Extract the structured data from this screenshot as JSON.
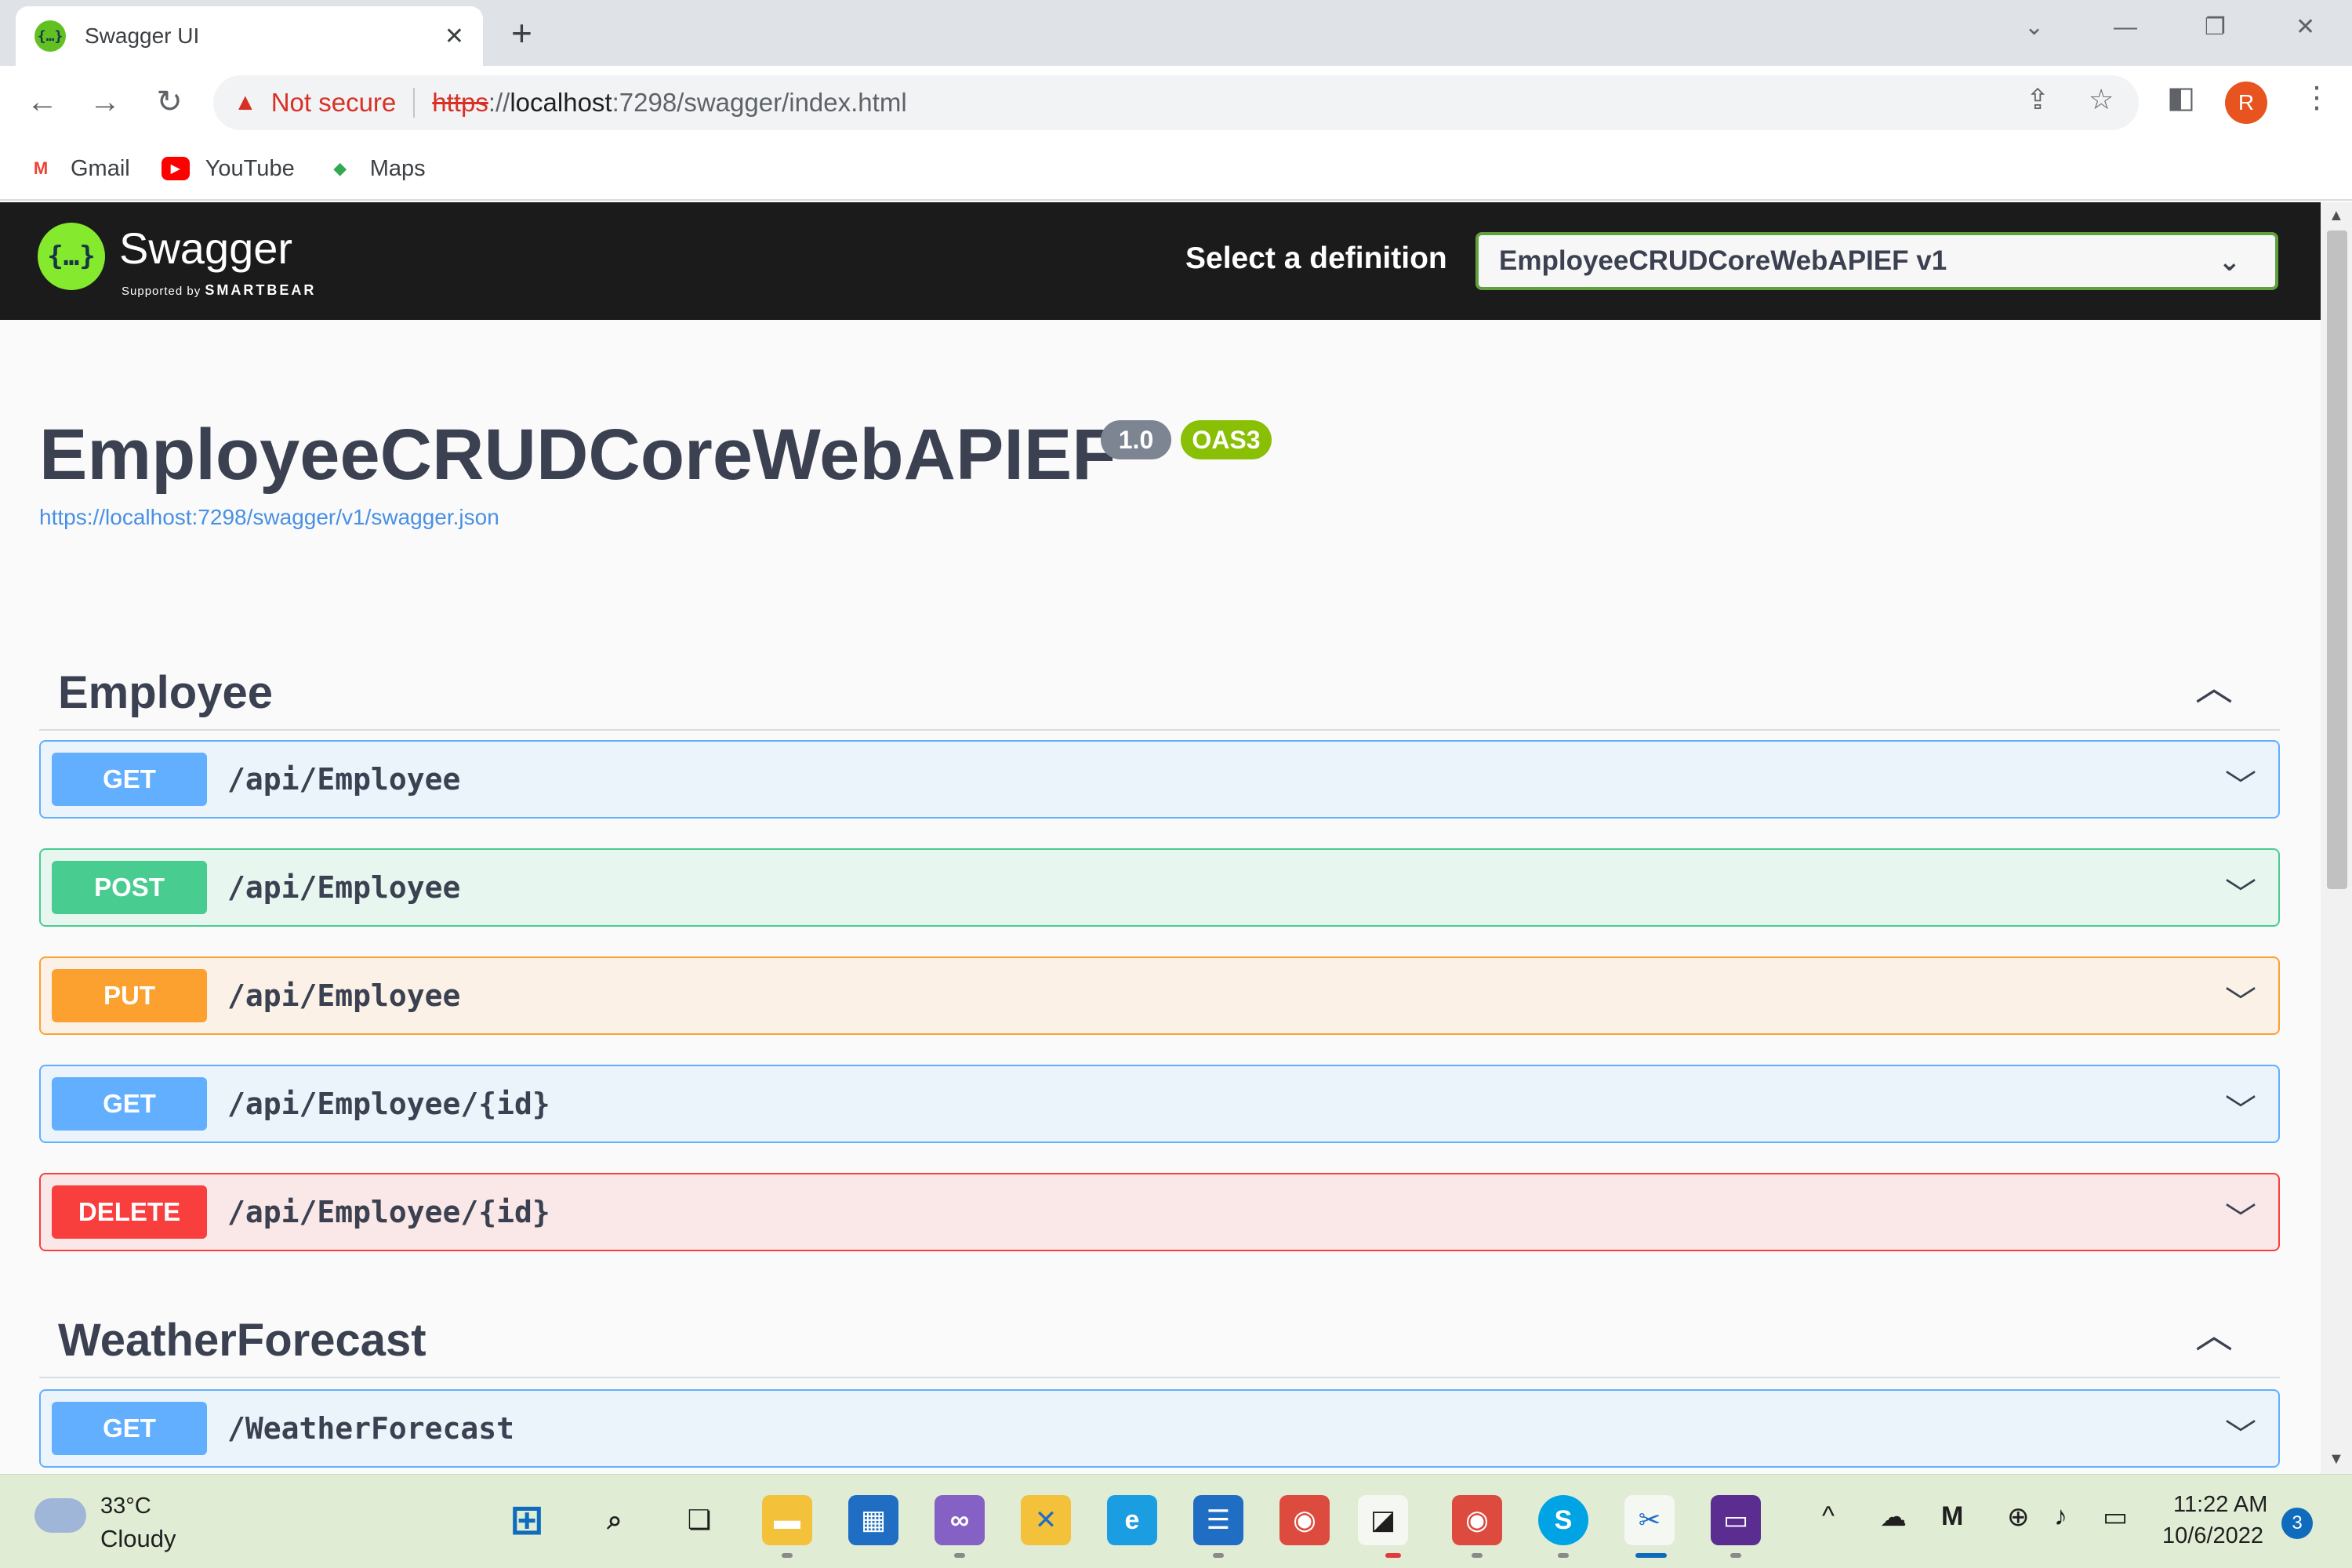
{
  "browser": {
    "tab_title": "Swagger UI",
    "tab_favicon": "swagger-favicon",
    "address": {
      "security_label": "Not secure",
      "url_scheme": "https",
      "url_sep": "://",
      "url_host": "localhost",
      "url_rest": ":7298/swagger/index.html"
    },
    "profile_initial": "R",
    "bookmarks": [
      {
        "label": "Gmail",
        "icon": "gmail-icon"
      },
      {
        "label": "YouTube",
        "icon": "youtube-icon"
      },
      {
        "label": "Maps",
        "icon": "maps-icon"
      }
    ]
  },
  "swagger": {
    "brand": "Swagger",
    "supported_by": "Supported by",
    "smartbear": "SMARTBEAR",
    "select_definition_label": "Select a definition",
    "selected_definition": "EmployeeCRUDCoreWebAPIEF v1",
    "title": "EmployeeCRUDCoreWebAPIEF",
    "version": "1.0",
    "oas": "OAS3",
    "spec_url": "https://localhost:7298/swagger/v1/swagger.json",
    "colors": {
      "get": "#61affe",
      "post": "#49cc90",
      "put": "#fca130",
      "delete": "#f93e3e",
      "topbar": "#1b1b1b",
      "logo": "#85ea2d"
    },
    "tags": [
      {
        "name": "Employee",
        "operations": [
          {
            "method": "GET",
            "path": "/api/Employee"
          },
          {
            "method": "POST",
            "path": "/api/Employee"
          },
          {
            "method": "PUT",
            "path": "/api/Employee"
          },
          {
            "method": "GET",
            "path": "/api/Employee/{id}"
          },
          {
            "method": "DELETE",
            "path": "/api/Employee/{id}"
          }
        ]
      },
      {
        "name": "WeatherForecast",
        "operations": [
          {
            "method": "GET",
            "path": "/WeatherForecast"
          }
        ]
      }
    ]
  },
  "taskbar": {
    "weather_temp": "33°C",
    "weather_desc": "Cloudy",
    "time": "11:22 AM",
    "date": "10/6/2022",
    "notification_count": "3"
  }
}
